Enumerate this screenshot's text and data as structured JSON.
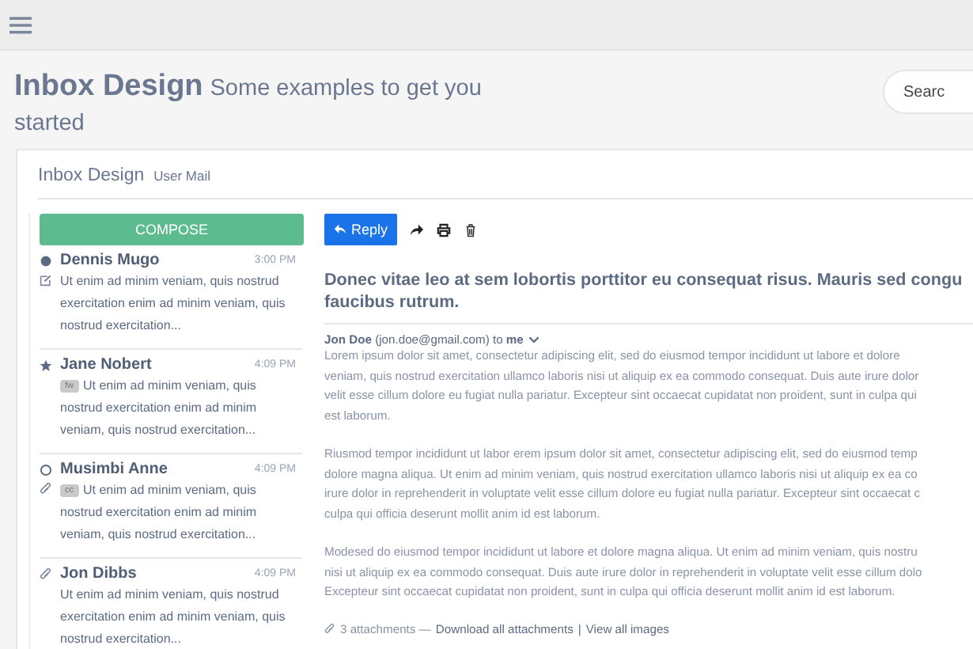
{
  "header": {
    "title": "Inbox Design",
    "subtitle": "Some examples to get you started",
    "search": {
      "placeholder": "Searc"
    }
  },
  "card": {
    "title": "Inbox Design",
    "subtitle": "User Mail"
  },
  "compose": "COMPOSE",
  "mails": [
    {
      "sender": "Dennis Mugo",
      "time": "3:00 PM",
      "kind": "unread",
      "draft": true,
      "attachment": false,
      "snippet": "Ut enim ad minim veniam, quis nostrud exercitation enim ad minim veniam, quis nostrud exercitation..."
    },
    {
      "sender": "Jane Nobert",
      "time": "4:09 PM",
      "kind": "starred",
      "draft": false,
      "attachment": false,
      "tag": "fw",
      "snippet": "Ut enim ad minim veniam, quis nostrud exercitation enim ad minim veniam, quis nostrud exercitation..."
    },
    {
      "sender": "Musimbi Anne",
      "time": "4:09 PM",
      "kind": "read",
      "draft": false,
      "attachment": true,
      "tag": "cc",
      "snippet": "Ut enim ad minim veniam, quis nostrud exercitation enim ad minim veniam, quis nostrud exercitation..."
    },
    {
      "sender": "Jon Dibbs",
      "time": "4:09 PM",
      "kind": "plain",
      "draft": false,
      "attachment": true,
      "snippet": "Ut enim ad minim veniam, quis nostrud exercitation enim ad minim veniam, quis nostrud exercitation..."
    }
  ],
  "message": {
    "reply": "Reply",
    "subject": [
      "Donec vitae leo at sem lobortis porttitor eu consequat risus. Mauris sed congu",
      "faucibus rutrum."
    ],
    "from": "**Jon Doe** (jon.doe@gmail.com) to **me**",
    "paragraphs": [
      [
        "Lorem ipsum dolor sit amet, consectetur adipiscing elit, sed do eiusmod tempor incididunt ut labore et dolore",
        "veniam, quis nostrud exercitation ullamco laboris nisi ut aliquip ex ea commodo consequat. Duis aute irure dolor",
        "velit esse cillum dolore eu fugiat nulla pariatur. Excepteur sint occaecat cupidatat non proident, sunt in culpa qui",
        "est laborum."
      ],
      [
        "Riusmod tempor incididunt ut labor erem ipsum dolor sit amet, consectetur adipiscing elit, sed do eiusmod temp",
        "dolore magna aliqua. Ut enim ad minim veniam, quis nostrud exercitation ullamco laboris nisi ut aliquip ex ea co",
        "irure dolor in reprehenderit in voluptate velit esse cillum dolore eu fugiat nulla pariatur. Excepteur sint occaecat c",
        "culpa qui officia deserunt mollit anim id est laborum."
      ],
      [
        "Modesed do eiusmod tempor incididunt ut labore et dolore magna aliqua. Ut enim ad minim veniam, quis nostru",
        "nisi ut aliquip ex ea commodo consequat. Duis aute irure dolor in reprehenderit in voluptate velit esse cillum dolo",
        "Excepteur sint occaecat cupidatat non proident, sunt in culpa qui officia deserunt mollit anim id est laborum."
      ]
    ],
    "attachments": {
      "count": "3 attachments —",
      "download": "Download all attachments",
      "separator": "|",
      "view": "View all images"
    }
  }
}
